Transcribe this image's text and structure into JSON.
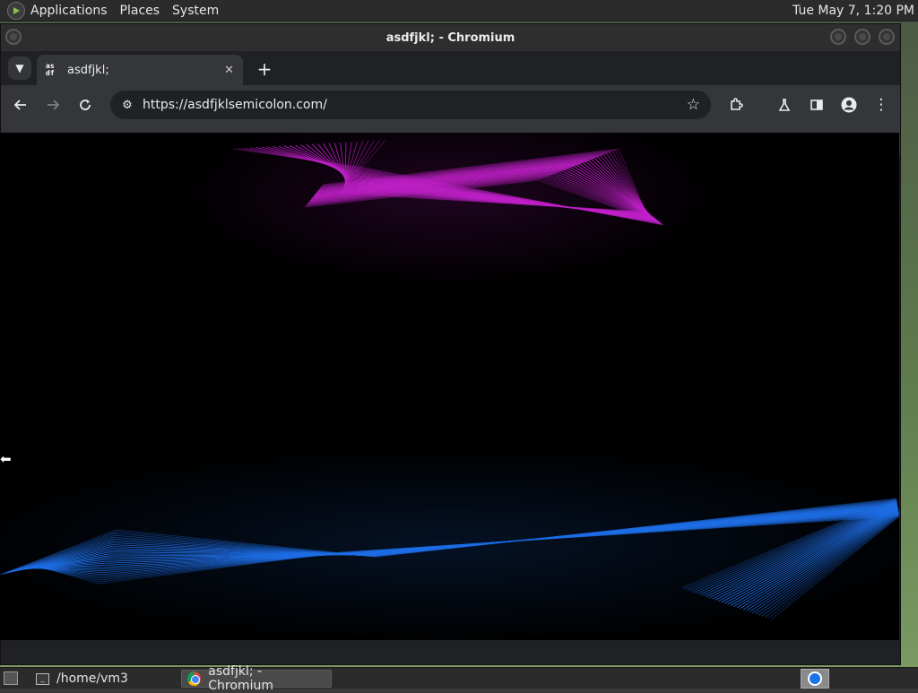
{
  "top_panel": {
    "menus": [
      "Applications",
      "Places",
      "System"
    ],
    "clock": "Tue May 7,  1:20 PM"
  },
  "window": {
    "title": "asdfjkl; - Chromium"
  },
  "browser": {
    "tab": {
      "favicon_text_top": "as",
      "favicon_text_bottom": "df",
      "title": "asdfjkl;"
    },
    "url": "https://asdfjklsemicolon.com/"
  },
  "taskbar": {
    "items": [
      {
        "label": "/home/vm3",
        "icon": "terminal-icon"
      },
      {
        "label": "asdfjkl; - Chromium",
        "icon": "chromium-icon"
      }
    ]
  },
  "colors": {
    "magenta_lines": "#c020c8",
    "blue_lines": "#1e6ee6",
    "page_bg": "#000000",
    "toolbar_bg": "#35363a",
    "tabstrip_bg": "#202124"
  }
}
